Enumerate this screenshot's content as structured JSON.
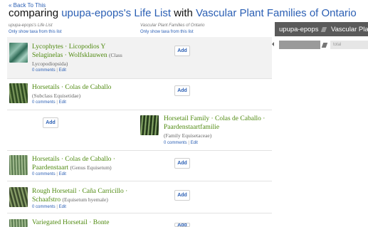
{
  "nav": {
    "back": "« Back To This"
  },
  "title": {
    "prefix": "comparing",
    "user_list": "upupa-epops's Life List",
    "with": "with",
    "other_list": "Vascular Plant Families of Ontario"
  },
  "columns": {
    "left_head": "upupa-epops's Life List",
    "left_sub": "Only show taxa from this list",
    "right_head": "Vascular Plant Families of Ontario",
    "right_sub": "Only show taxa from this list"
  },
  "rows": [
    {
      "name": "Lycophytes · Licopodios Y Selaginelas · Wolfsklauwen",
      "rank": "(Class Lycopodiopsida)",
      "comments": "0 comments",
      "edit": "Edit",
      "add": "Add"
    },
    {
      "name": "Horsetails · Colas de Caballo",
      "rank": "(Subclass Equisetidae)",
      "comments": "0 comments",
      "edit": "Edit",
      "add": "Add"
    },
    {
      "name": "Horsetail Family · Colas de Caballo · Paardenstaartfamilie",
      "rank": "(Family Equisetaceae)",
      "comments": "0 comments",
      "edit": "Edit",
      "add": "Add"
    },
    {
      "name": "Horsetails · Colas de Caballo · Paardenstaart",
      "rank": "(Genus Equisetum)",
      "comments": "0 comments",
      "edit": "Edit",
      "add": "Add"
    },
    {
      "name": "Rough Horsetail · Caña Carricillo · Schaafstro",
      "rank": "(Equisetum hyemale)",
      "comments": "0 comments",
      "edit": "Edit",
      "add": "Add"
    },
    {
      "name": "Variegated Horsetail · Bonte",
      "add": "Add"
    }
  ],
  "side_panel": {
    "tab_left": "upupa-epops",
    "tab_right": "Vascular Pla",
    "total_label": "total"
  }
}
